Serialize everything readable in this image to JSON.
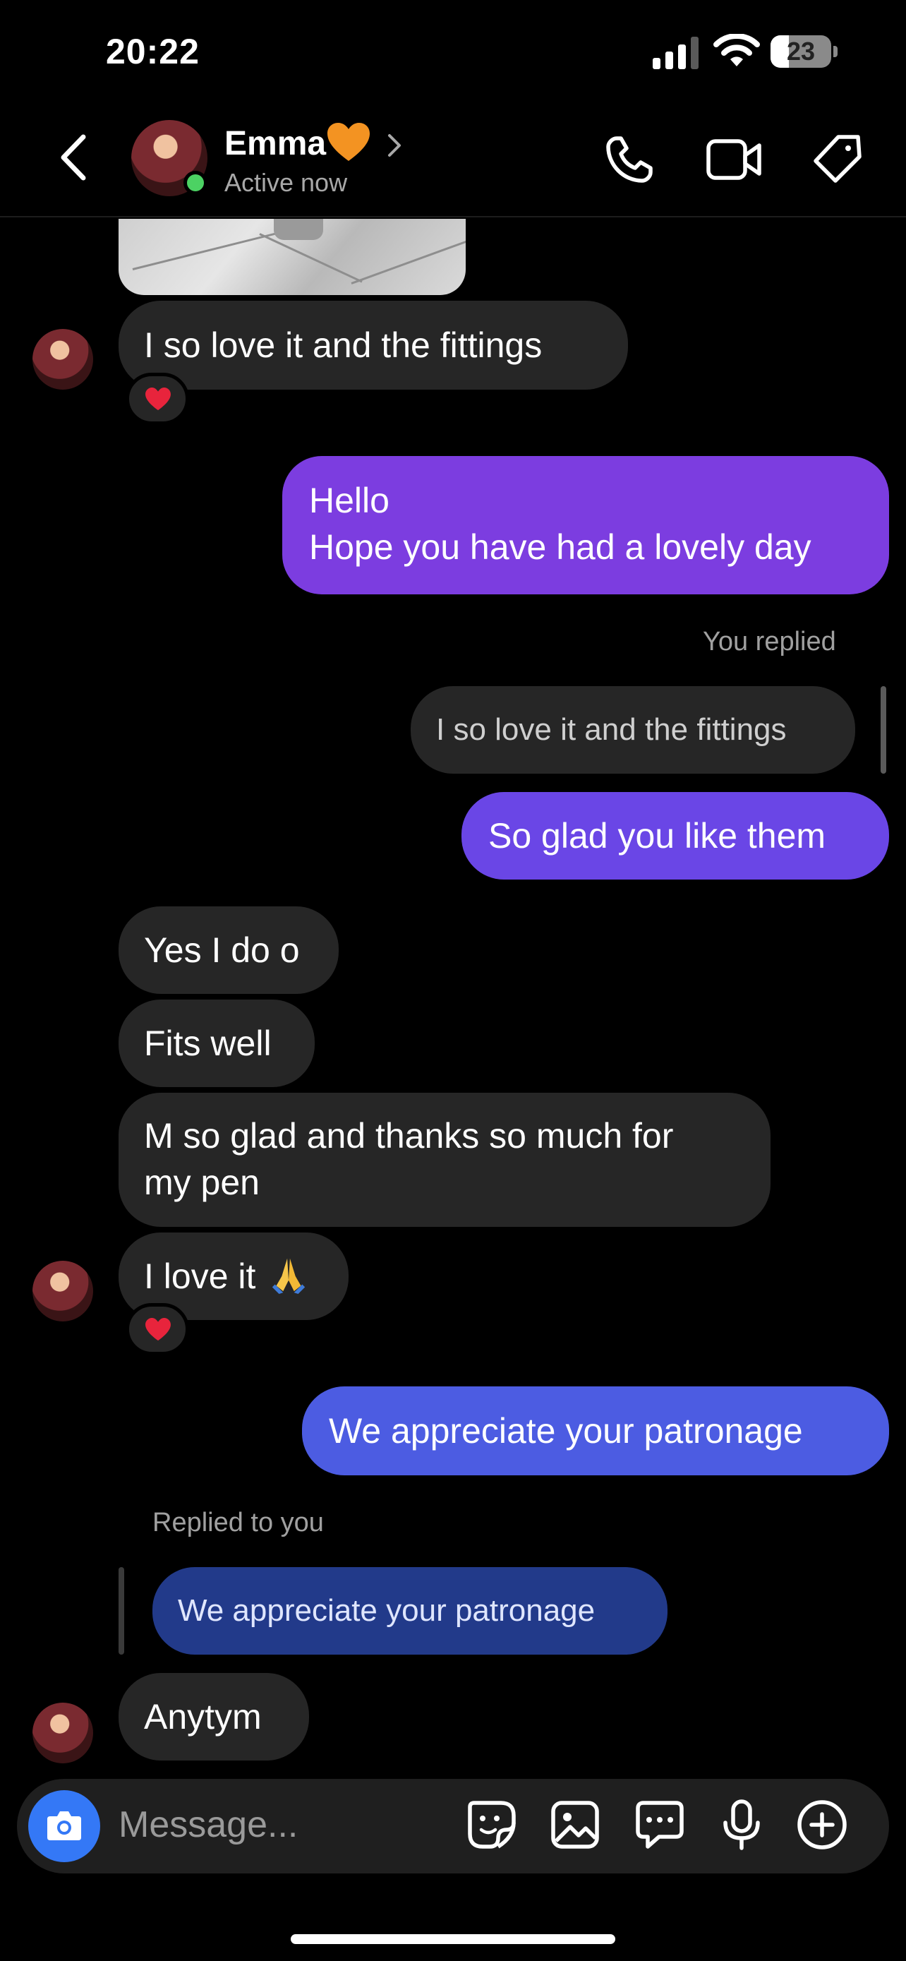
{
  "status_bar": {
    "time": "20:22",
    "battery": "23"
  },
  "header": {
    "name": "Emma",
    "name_emoji": "orange-heart",
    "status": "Active now",
    "icons": [
      "back-icon",
      "phone-icon",
      "video-camera-icon",
      "tag-icon"
    ]
  },
  "messages": [
    {
      "from": "them",
      "text": "I so love it and the fittings",
      "reaction": "red-heart"
    },
    {
      "from": "me",
      "lines": [
        "Hello",
        "Hope you have had a lovely day"
      ]
    },
    {
      "from": "me",
      "reply_label": "You replied",
      "quoted": "I so love it and the fittings",
      "text": "So glad you like them"
    },
    {
      "from": "them",
      "text": "Yes I do o"
    },
    {
      "from": "them",
      "text": "Fits well"
    },
    {
      "from": "them",
      "lines": [
        "M so glad and thanks so much for",
        "my pen"
      ]
    },
    {
      "from": "them",
      "text": "I love it",
      "emoji": "folded-hands",
      "reaction": "red-heart"
    },
    {
      "from": "me",
      "text": "We appreciate your patronage"
    },
    {
      "from": "them",
      "reply_label": "Replied to you",
      "quoted": "We appreciate your patronage",
      "text": "Anytym"
    }
  ],
  "composer": {
    "placeholder": "Message...",
    "icons": [
      "camera-icon",
      "sticker-icon",
      "gallery-icon",
      "chat-bubble-icon",
      "microphone-icon",
      "add-icon"
    ]
  },
  "colors": {
    "background": "#000000",
    "incoming_bubble": "#262626",
    "outgoing_gradient": [
      "#7c3de0",
      "#6a46e6",
      "#4c5ce2"
    ],
    "online": "#4cd263",
    "camera_button": "#3478f6"
  }
}
